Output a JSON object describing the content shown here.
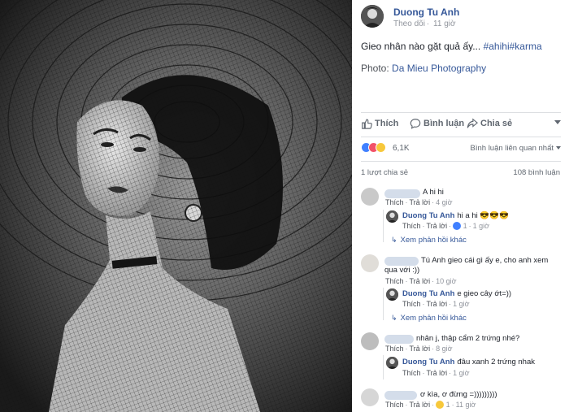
{
  "post": {
    "author": "Duong Tu Anh",
    "follow_label": "Theo dõi",
    "time": "11 giờ",
    "text": "Gieo nhân nào gặt quả ấy...",
    "hashtags": "#ahihi#karma",
    "credit_prefix": "Photo:",
    "credit_link": "Da Mieu Photography"
  },
  "actions": {
    "like": "Thích",
    "comment": "Bình luận",
    "share": "Chia sẻ"
  },
  "reactions": {
    "count": "6,1K",
    "sort_label": "Bình luận liên quan nhất",
    "types": [
      "like",
      "love",
      "haha"
    ],
    "colors": {
      "like": "#4080ff",
      "love": "#f25268",
      "haha": "#f7c83b"
    }
  },
  "stats": {
    "shares": "1 lượt chia sẻ",
    "comments": "108 bình luận"
  },
  "comments": [
    {
      "text": "A hi hi",
      "like": "Thích",
      "reply": "Trả lời",
      "time": "4 giờ",
      "replies": [
        {
          "name": "Duong Tu Anh",
          "text": "hi a hi",
          "emoji": "😎😎😎",
          "like": "Thích",
          "reply": "Trả lời",
          "reactions": "1",
          "time": "1 giờ"
        }
      ],
      "more": "Xem phản hồi khác"
    },
    {
      "text_line1": "Tú Anh gieo cái gì ấy e, cho anh xem",
      "text_line2": "qua với :))",
      "like": "Thích",
      "reply": "Trả lời",
      "time": "10 giờ",
      "replies": [
        {
          "name": "Duong Tu Anh",
          "text": "e gieo cây ớt=))",
          "like": "Thích",
          "reply": "Trả lời",
          "time": "1 giờ"
        }
      ],
      "more": "Xem phản hồi khác"
    },
    {
      "text": "nhân j, thập cẩm 2 trứng nhé?",
      "like": "Thích",
      "reply": "Trả lời",
      "time": "8 giờ",
      "replies": [
        {
          "name": "Duong Tu Anh",
          "text": "đâu xanh 2 trứng nhak",
          "like": "Thích",
          "reply": "Trả lời",
          "time": "1 giờ"
        }
      ]
    },
    {
      "text": "ơ kìa, ơ đừng =)))))))))",
      "like": "Thích",
      "reply": "Trả lời",
      "reactions": "1",
      "time": "11 giờ"
    }
  ],
  "colors": {
    "link": "#365899",
    "muted": "#90949c",
    "divider": "#dddfe2"
  }
}
